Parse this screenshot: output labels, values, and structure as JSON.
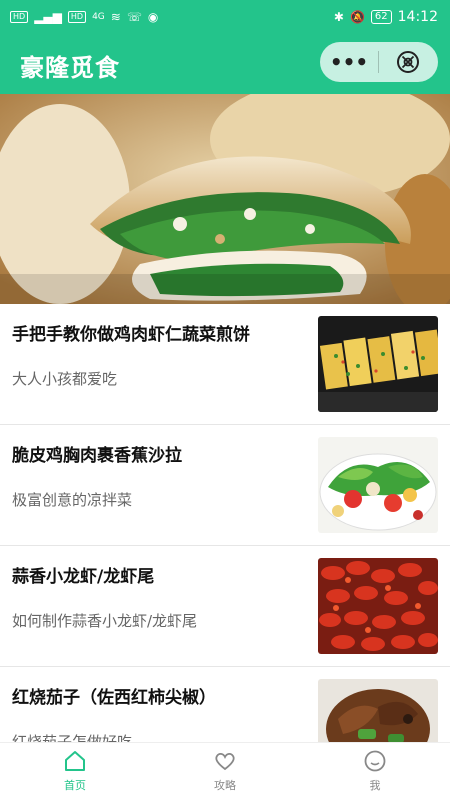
{
  "status_bar": {
    "left_tag_1": "HD",
    "left_tag_2": "HD",
    "network": "4G",
    "battery": "62",
    "time": "14:12"
  },
  "header": {
    "title": "豪隆觅食",
    "more_label": "•••"
  },
  "articles": [
    {
      "title": "手把手教你做鸡肉虾仁蔬菜煎饼",
      "subtitle": "大人小孩都爱吃"
    },
    {
      "title": "脆皮鸡胸肉裹香蕉沙拉",
      "subtitle": "极富创意的凉拌菜"
    },
    {
      "title": "蒜香小龙虾/龙虾尾",
      "subtitle": "如何制作蒜香小龙虾/龙虾尾"
    },
    {
      "title": "红烧茄子（佐西红柿尖椒）",
      "subtitle": "红烧茄子怎做好吃"
    }
  ],
  "tabs": [
    {
      "label": "首页"
    },
    {
      "label": "攻略"
    },
    {
      "label": "我"
    }
  ],
  "colors": {
    "brand": "#23c48b",
    "text": "#111111",
    "subtext": "#666666"
  }
}
